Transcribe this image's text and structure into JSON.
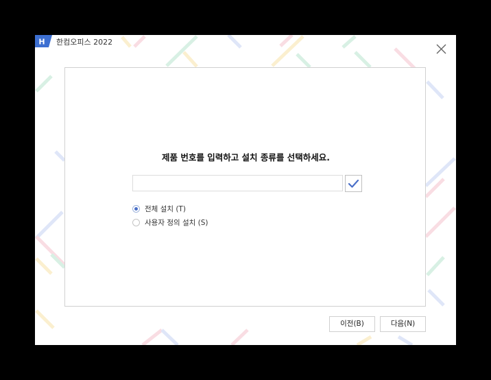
{
  "window": {
    "title": "한컴오피스 2022",
    "logo_letter": "H"
  },
  "main": {
    "heading": "제품 번호를 입력하고 설치 종류를 선택하세요.",
    "serial_input": {
      "value": "",
      "placeholder": ""
    },
    "install_options": [
      {
        "label": "전체 설치 (T)",
        "checked": true
      },
      {
        "label": "사용자 정의 설치 (S)",
        "checked": false
      }
    ]
  },
  "footer": {
    "prev_label": "이전(B)",
    "next_label": "다음(N)"
  },
  "colors": {
    "accent": "#4a6fc8",
    "logo_bg": "#3d6fd1",
    "deco_green": "#d8f0e4",
    "deco_pink": "#f9dde3",
    "deco_yellow": "#fbefcf",
    "deco_blue": "#dfe6f8"
  },
  "icons": {
    "logo": "hancom-logo-icon",
    "close": "close-icon",
    "verify": "checkmark-icon"
  }
}
